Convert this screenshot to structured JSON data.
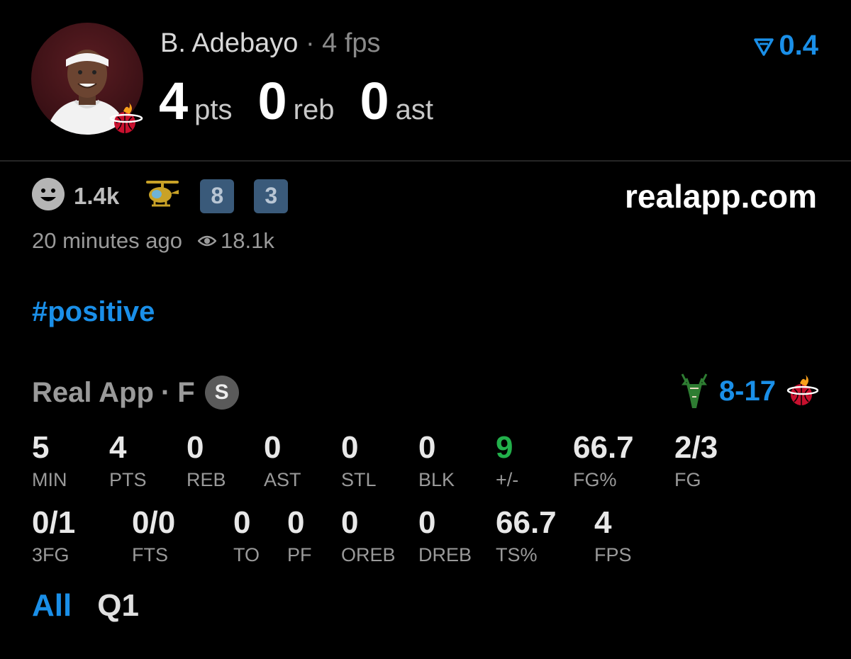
{
  "header": {
    "player_name": "B. Adebayo",
    "separator": "·",
    "fps_label": "4 fps",
    "pts_value": "4",
    "pts_unit": "pts",
    "reb_value": "0",
    "reb_unit": "reb",
    "ast_value": "0",
    "ast_unit": "ast",
    "vote_value": "0.4"
  },
  "reactions": {
    "smile_count": "1.4k",
    "badge_1": "8",
    "badge_2": "3",
    "site": "realapp.com",
    "time_ago": "20 minutes ago",
    "views": "18.1k"
  },
  "hashtag": "#positive",
  "game": {
    "source": "Real App",
    "separator": "·",
    "status": "F",
    "s_badge": "S",
    "score": "8-17"
  },
  "stats_row1": [
    {
      "value": "5",
      "label": "MIN"
    },
    {
      "value": "4",
      "label": "PTS"
    },
    {
      "value": "0",
      "label": "REB"
    },
    {
      "value": "0",
      "label": "AST"
    },
    {
      "value": "0",
      "label": "STL"
    },
    {
      "value": "0",
      "label": "BLK"
    },
    {
      "value": "9",
      "label": "+/-"
    },
    {
      "value": "66.7",
      "label": "FG%"
    },
    {
      "value": "2/3",
      "label": "FG"
    }
  ],
  "stats_row2": [
    {
      "value": "0/1",
      "label": "3FG"
    },
    {
      "value": "0/0",
      "label": "FTS"
    },
    {
      "value": "0",
      "label": "TO"
    },
    {
      "value": "0",
      "label": "PF"
    },
    {
      "value": "0",
      "label": "OREB"
    },
    {
      "value": "0",
      "label": "DREB"
    },
    {
      "value": "66.7",
      "label": "TS%"
    },
    {
      "value": "4",
      "label": "FPS"
    }
  ],
  "filters": {
    "all": "All",
    "q1": "Q1"
  },
  "colors": {
    "accent": "#1a8fe8",
    "positive": "#22b04b",
    "heat_red": "#c8102e",
    "bucks_green": "#00471b"
  },
  "icons": {
    "smile": "smile-icon",
    "helicopter": "helicopter-icon",
    "eye": "eye-icon",
    "vote": "downvote-icon",
    "heat": "heat-logo-icon",
    "bucks": "bucks-logo-icon"
  }
}
